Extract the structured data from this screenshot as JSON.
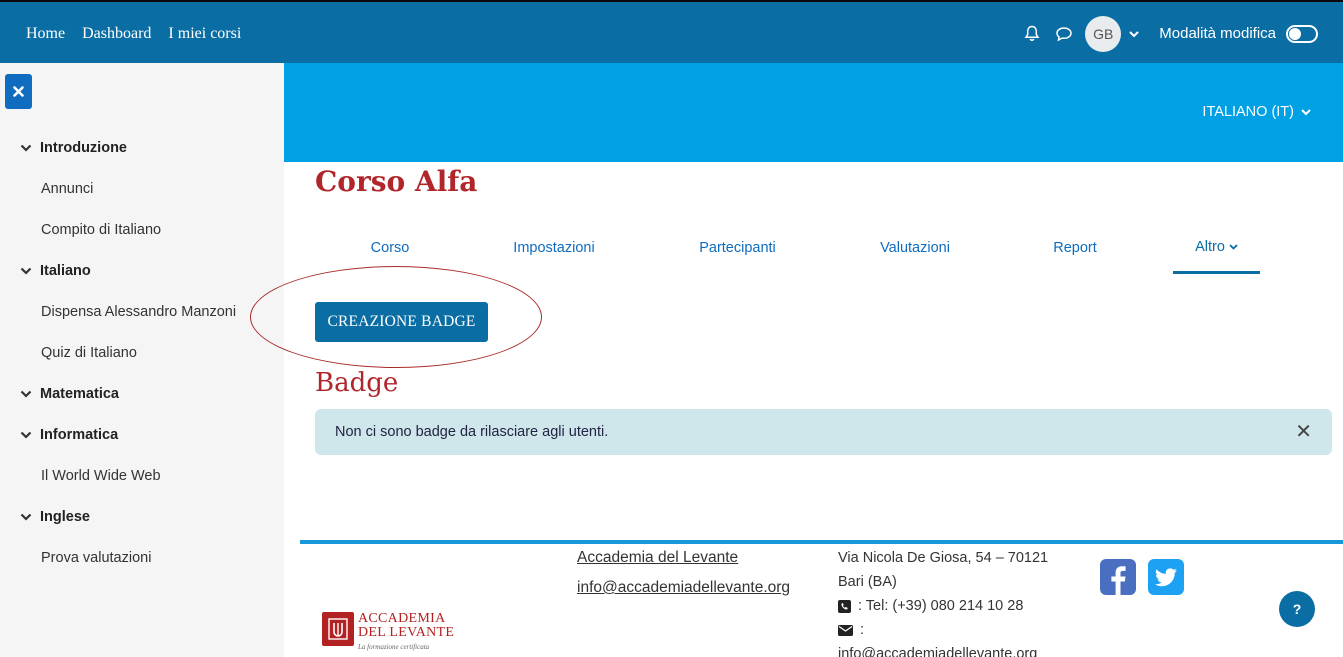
{
  "navbar": {
    "links": [
      "Home",
      "Dashboard",
      "I miei corsi"
    ],
    "avatar_initials": "GB",
    "edit_mode_label": "Modalità modifica"
  },
  "drawer": {
    "items": [
      {
        "type": "section",
        "label": "Introduzione"
      },
      {
        "type": "item",
        "label": "Annunci"
      },
      {
        "type": "item",
        "label": "Compito di Italiano"
      },
      {
        "type": "section",
        "label": "Italiano"
      },
      {
        "type": "item",
        "label": "Dispensa Alessandro Manzoni"
      },
      {
        "type": "item",
        "label": "Quiz di Italiano"
      },
      {
        "type": "section",
        "label": "Matematica"
      },
      {
        "type": "section",
        "label": "Informatica"
      },
      {
        "type": "item",
        "label": "Il World Wide Web"
      },
      {
        "type": "section",
        "label": "Inglese"
      },
      {
        "type": "item",
        "label": "Prova valutazioni"
      }
    ]
  },
  "header": {
    "language": "ITALIANO (IT)"
  },
  "course": {
    "title": "Corso Alfa",
    "tabs": [
      {
        "label": "Corso"
      },
      {
        "label": "Impostazioni"
      },
      {
        "label": "Partecipanti"
      },
      {
        "label": "Valutazioni"
      },
      {
        "label": "Report"
      },
      {
        "label": "Altro"
      }
    ],
    "active_tab": "Altro"
  },
  "main": {
    "create_badge_label": "CREAZIONE BADGE",
    "section_title": "Badge",
    "alert_text": "Non ci sono badge da rilasciare agli utenti."
  },
  "footer": {
    "org_name": "Accademia del Levante",
    "org_email": "info@accademiadellevante.org",
    "address_line1": "Via Nicola De Giosa, 54 – 70121",
    "address_line2": "Bari (BA)",
    "phone": ": Tel: (+39) 080 214 10 28",
    "email_label": ":",
    "email_contact": "info@accademiadellevante.org",
    "logo_line1": "ACCADEMIA",
    "logo_line2": "DEL LEVANTE",
    "logo_line3": "La formazione certificata"
  },
  "colors": {
    "navbar": "#0a6ea4",
    "band": "#00a0e4",
    "accent_title": "#b0262b",
    "alert_bg": "#cfe7ea"
  }
}
